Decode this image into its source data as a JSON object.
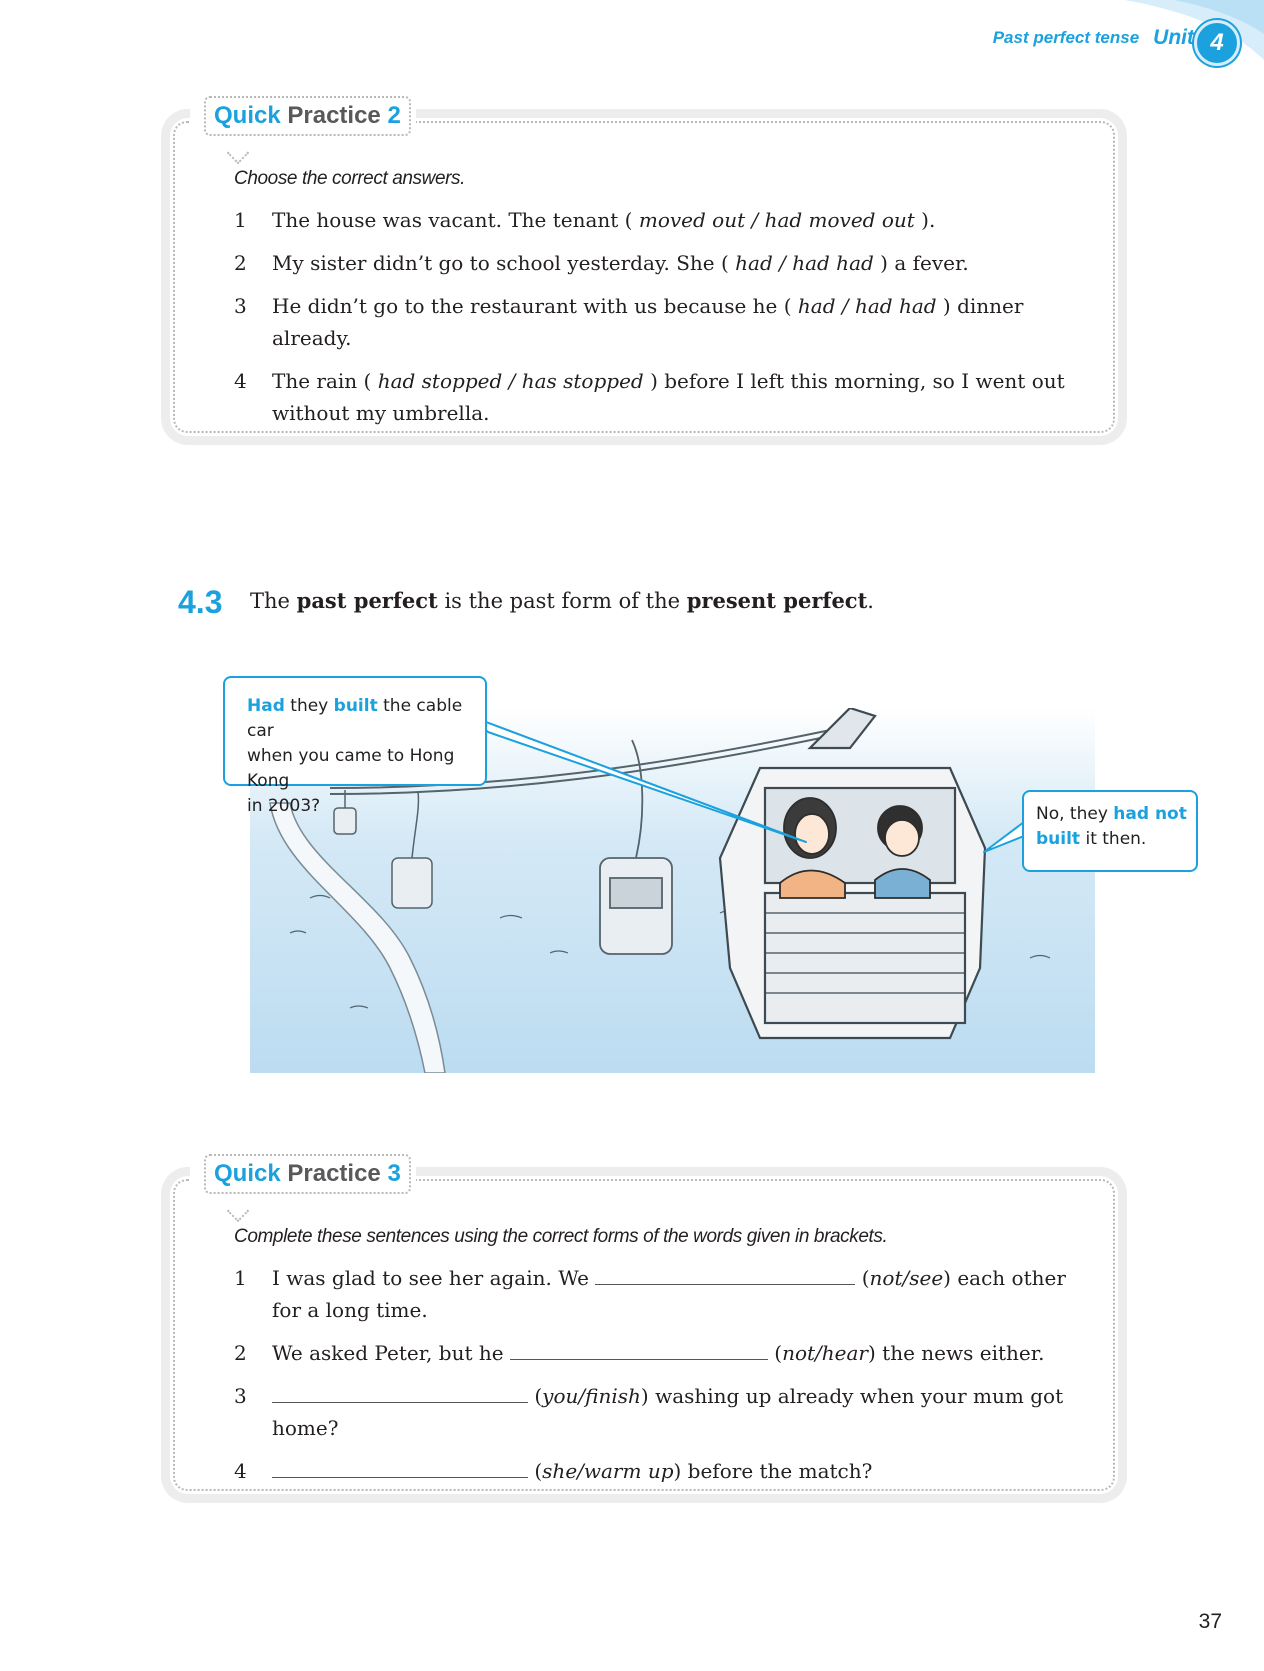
{
  "header": {
    "topic": "Past perfect tense",
    "unit_label": "Unit",
    "unit_number": "4"
  },
  "qp2": {
    "quick": "Quick",
    "practice": "Practice",
    "number": "2",
    "instruction": "Choose the correct answers.",
    "items": [
      {
        "n": "1",
        "before": "The house was vacant. The tenant ( ",
        "options": "moved out / had moved out",
        "after": " )."
      },
      {
        "n": "2",
        "before": "My sister didn’t go to school yesterday. She ( ",
        "options": "had / had had",
        "after": " ) a fever."
      },
      {
        "n": "3",
        "before": "He didn’t go to the restaurant with us because he ( ",
        "options": "had / had had",
        "after": " ) dinner already."
      },
      {
        "n": "4",
        "before": "The rain ( ",
        "options": "had stopped / has stopped",
        "after": " ) before I left this morning, so I went out without my umbrella."
      }
    ]
  },
  "section": {
    "number": "4.3",
    "text_1": "The ",
    "bold_1": "past perfect",
    "text_2": " is the past form of the ",
    "bold_2": "present perfect",
    "text_3": "."
  },
  "illustration": {
    "bubble_left": {
      "hl1": "Had",
      "t1": " they ",
      "hl2": "built",
      "t2": " the cable car",
      "line2": "when you came to Hong Kong",
      "line3": "in 2003?"
    },
    "bubble_right": {
      "t1": "No, they ",
      "hl1": "had not",
      "hl2": "built",
      "t2": " it then."
    }
  },
  "qp3": {
    "quick": "Quick",
    "practice": "Practice",
    "number": "3",
    "instruction": "Complete these sentences using the correct forms of the words given in brackets.",
    "items": [
      {
        "n": "1",
        "before": "I  was glad to see her again. We ",
        "hint": "not/see",
        "after": " each other for a long time."
      },
      {
        "n": "2",
        "before": "We asked Peter, but he ",
        "hint": "not/hear",
        "after": " the news either."
      },
      {
        "n": "3",
        "before": "",
        "hint": "you/finish",
        "after": " washing up already when your mum got home?"
      },
      {
        "n": "4",
        "before": "",
        "hint": "she/warm up",
        "after": " before the match?"
      }
    ]
  },
  "page_number": "37",
  "colors": {
    "accent": "#1ba1dd",
    "sky": "#cfe6f5",
    "box_shadow": "#ededed"
  }
}
